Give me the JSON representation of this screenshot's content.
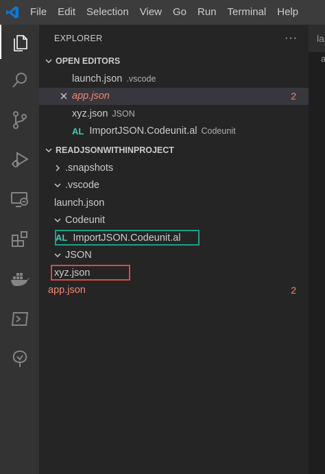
{
  "menu": [
    "File",
    "Edit",
    "Selection",
    "View",
    "Go",
    "Run",
    "Terminal",
    "Help"
  ],
  "explorer": {
    "title": "EXPLORER",
    "more": "···"
  },
  "open_editors": {
    "title": "OPEN EDITORS",
    "items": [
      {
        "name": "launch.json",
        "desc": ".vscode"
      },
      {
        "name": "app.json",
        "badge": "2"
      },
      {
        "name": "xyz.json",
        "desc": "JSON"
      },
      {
        "name": "ImportJSON.Codeunit.al",
        "desc": "Codeunit",
        "type": "AL"
      }
    ]
  },
  "project": {
    "title": "READJSONWITHINPROJECT",
    "items": [
      {
        "name": ".snapshots"
      },
      {
        "name": ".vscode"
      },
      {
        "name": "launch.json"
      },
      {
        "name": "Codeunit"
      },
      {
        "name": "ImportJSON.Codeunit.al",
        "type": "AL"
      },
      {
        "name": "JSON"
      },
      {
        "name": "xyz.json"
      },
      {
        "name": "app.json",
        "badge": "2"
      }
    ]
  },
  "editor": {
    "tab_fragment": "la",
    "text_fragment": "a"
  },
  "colors": {
    "accent_vscode": "#0a7ad6",
    "modified": "#f48771",
    "al": "#4ec9b0",
    "annotation_green": "#1aa38a",
    "annotation_red": "#e04848"
  }
}
